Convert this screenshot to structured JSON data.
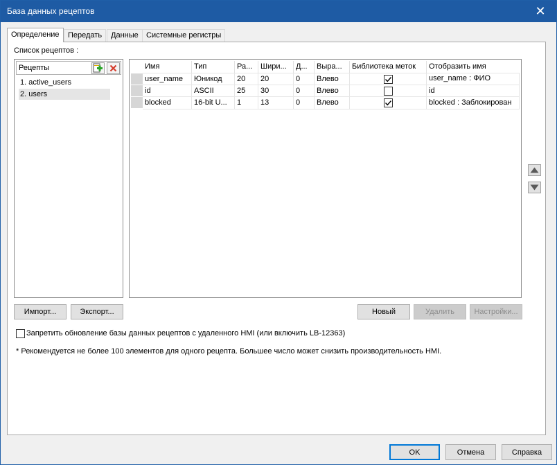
{
  "window": {
    "title": "База данных рецептов",
    "close_glyph": "✕"
  },
  "tabs": [
    "Определение",
    "Передать",
    "Данные",
    "Системные регистры"
  ],
  "recipe_list_label": "Список рецептов :",
  "recipes": {
    "header": "Рецепты",
    "add_icon": "add-recipe-icon",
    "delete_icon": "delete-recipe-icon",
    "items": [
      "1. active_users",
      "2. users"
    ],
    "selected_index": 1
  },
  "grid": {
    "columns": [
      "Имя",
      "Тип",
      "Ра...",
      "Шири...",
      "Д...",
      "Выра...",
      "Библиотека меток",
      "Отобразить имя"
    ],
    "rows": [
      {
        "name": "user_name",
        "type": "Юникод",
        "size": "20",
        "width": "20",
        "decimal": "0",
        "align": "Влево",
        "label_lib": true,
        "display": "user_name : ФИО"
      },
      {
        "name": "id",
        "type": "ASCII",
        "size": "25",
        "width": "30",
        "decimal": "0",
        "align": "Влево",
        "label_lib": false,
        "display": "id"
      },
      {
        "name": "blocked",
        "type": "16-bit U...",
        "size": "1",
        "width": "13",
        "decimal": "0",
        "align": "Влево",
        "label_lib": true,
        "display": "blocked : Заблокирован"
      }
    ]
  },
  "buttons": {
    "import": "Импорт...",
    "export": "Экспорт...",
    "new": "Новый",
    "delete": "Удалить",
    "settings": "Настройки...",
    "ok": "OK",
    "cancel": "Отмена",
    "help": "Справка"
  },
  "prohibit_update": {
    "label": "Запретить обновление базы данных рецептов с удаленного HMI (или включить LB-12363)",
    "checked": false
  },
  "note": "* Рекомендуется не более 100 элементов для одного рецепта. Большее число может снизить производительность HMI.",
  "colors": {
    "titlebar": "#1e5ba4",
    "default_button_border": "#0078d7",
    "add_icon": "#2aa52a",
    "delete_icon": "#d43c2c"
  }
}
